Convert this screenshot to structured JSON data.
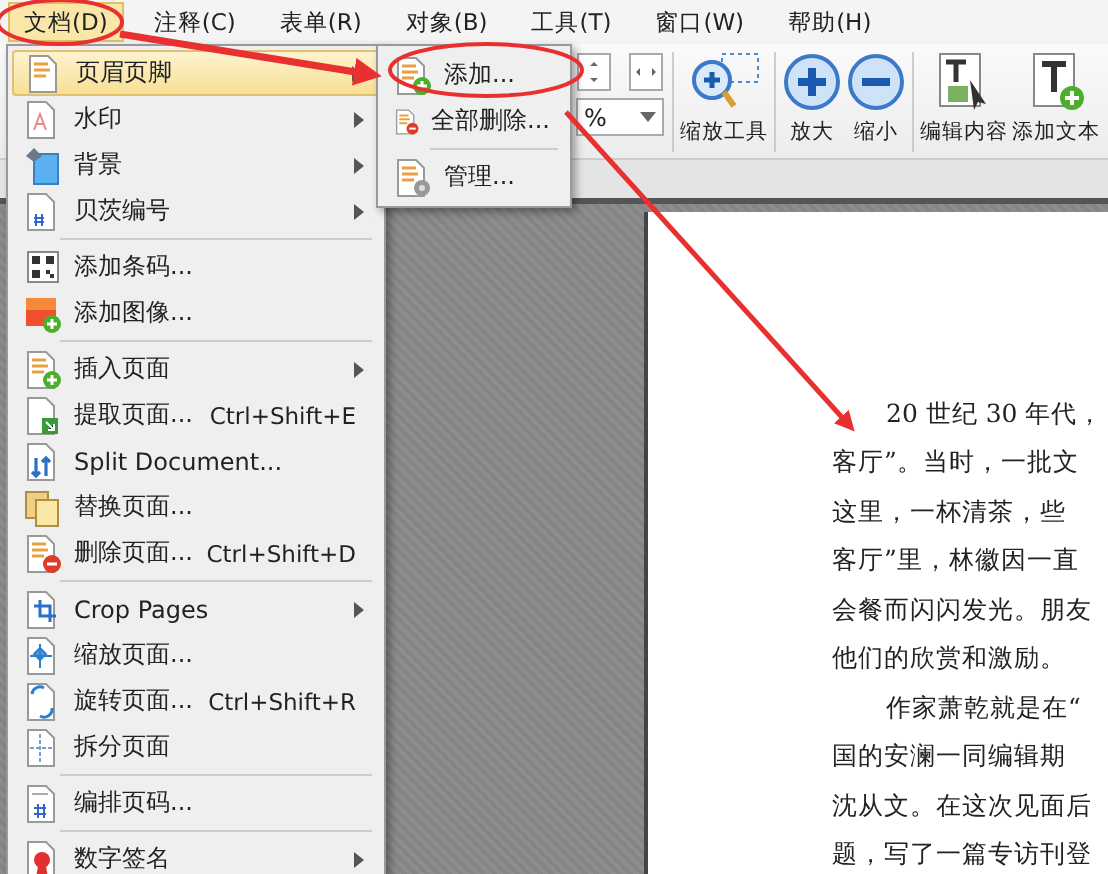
{
  "menubar": [
    {
      "label": "文档(D)",
      "selected": true
    },
    {
      "label": "注释(C)",
      "selected": false
    },
    {
      "label": "表单(R)",
      "selected": false
    },
    {
      "label": "对象(B)",
      "selected": false
    },
    {
      "label": "工具(T)",
      "selected": false
    },
    {
      "label": "窗口(W)",
      "selected": false
    },
    {
      "label": "帮助(H)",
      "selected": false
    }
  ],
  "toolbar": {
    "zoom_field": {
      "value": "%"
    },
    "buttons": [
      {
        "label": "缩放工具"
      },
      {
        "label": "放大"
      },
      {
        "label": "缩小"
      },
      {
        "label": "编辑内容"
      },
      {
        "label": "添加文本"
      }
    ]
  },
  "document_menu": {
    "items": [
      {
        "kind": "item",
        "label": "页眉页脚",
        "has_submenu": true,
        "selected": true
      },
      {
        "kind": "item",
        "label": "水印",
        "has_submenu": true,
        "selected": false
      },
      {
        "kind": "item",
        "label": "背景",
        "has_submenu": true,
        "selected": false
      },
      {
        "kind": "item",
        "label": "贝茨编号",
        "has_submenu": true,
        "selected": false
      },
      {
        "kind": "separator"
      },
      {
        "kind": "item",
        "label": "添加条码...",
        "has_submenu": false,
        "selected": false
      },
      {
        "kind": "item",
        "label": "添加图像...",
        "has_submenu": false,
        "selected": false
      },
      {
        "kind": "separator"
      },
      {
        "kind": "item",
        "label": "插入页面",
        "has_submenu": true,
        "selected": false
      },
      {
        "kind": "item",
        "label": "提取页面...",
        "shortcut": "Ctrl+Shift+E",
        "has_submenu": false,
        "selected": false
      },
      {
        "kind": "item",
        "label": "Split Document...",
        "has_submenu": false,
        "selected": false
      },
      {
        "kind": "item",
        "label": "替换页面...",
        "has_submenu": false,
        "selected": false
      },
      {
        "kind": "item",
        "label": "删除页面...",
        "shortcut": "Ctrl+Shift+D",
        "has_submenu": false,
        "selected": false
      },
      {
        "kind": "separator"
      },
      {
        "kind": "item",
        "label": "Crop Pages",
        "has_submenu": true,
        "selected": false
      },
      {
        "kind": "item",
        "label": "缩放页面...",
        "has_submenu": false,
        "selected": false
      },
      {
        "kind": "item",
        "label": "旋转页面...",
        "shortcut": "Ctrl+Shift+R",
        "has_submenu": false,
        "selected": false
      },
      {
        "kind": "item",
        "label": "拆分页面",
        "has_submenu": false,
        "selected": false
      },
      {
        "kind": "separator"
      },
      {
        "kind": "item",
        "label": "编排页码...",
        "has_submenu": false,
        "selected": false
      },
      {
        "kind": "separator"
      },
      {
        "kind": "item",
        "label": "数字签名",
        "has_submenu": true,
        "selected": false
      }
    ]
  },
  "header_footer_submenu": {
    "items": [
      {
        "kind": "item",
        "label": "添加..."
      },
      {
        "kind": "item",
        "label": "全部删除..."
      },
      {
        "kind": "separator"
      },
      {
        "kind": "item",
        "label": "管理..."
      }
    ]
  },
  "document": {
    "lines": [
      {
        "text": "20 世纪 30 年代，",
        "indent": true
      },
      {
        "text": "客厅”。当时，一批文",
        "indent": false
      },
      {
        "text": "这里，一杯清茶，些",
        "indent": false
      },
      {
        "text": "客厅”里，林徽因一直",
        "indent": false
      },
      {
        "text": "会餐而闪闪发光。朋友",
        "indent": false
      },
      {
        "text": "他们的欣赏和激励。",
        "indent": false
      },
      {
        "text": "作家萧乾就是在“",
        "indent": true
      },
      {
        "text": "国的安澜一同编辑期",
        "indent": false
      },
      {
        "text": "沈从文。在这次见面后",
        "indent": false
      },
      {
        "text": "题，写了一篇专访刊登",
        "indent": false
      }
    ]
  }
}
